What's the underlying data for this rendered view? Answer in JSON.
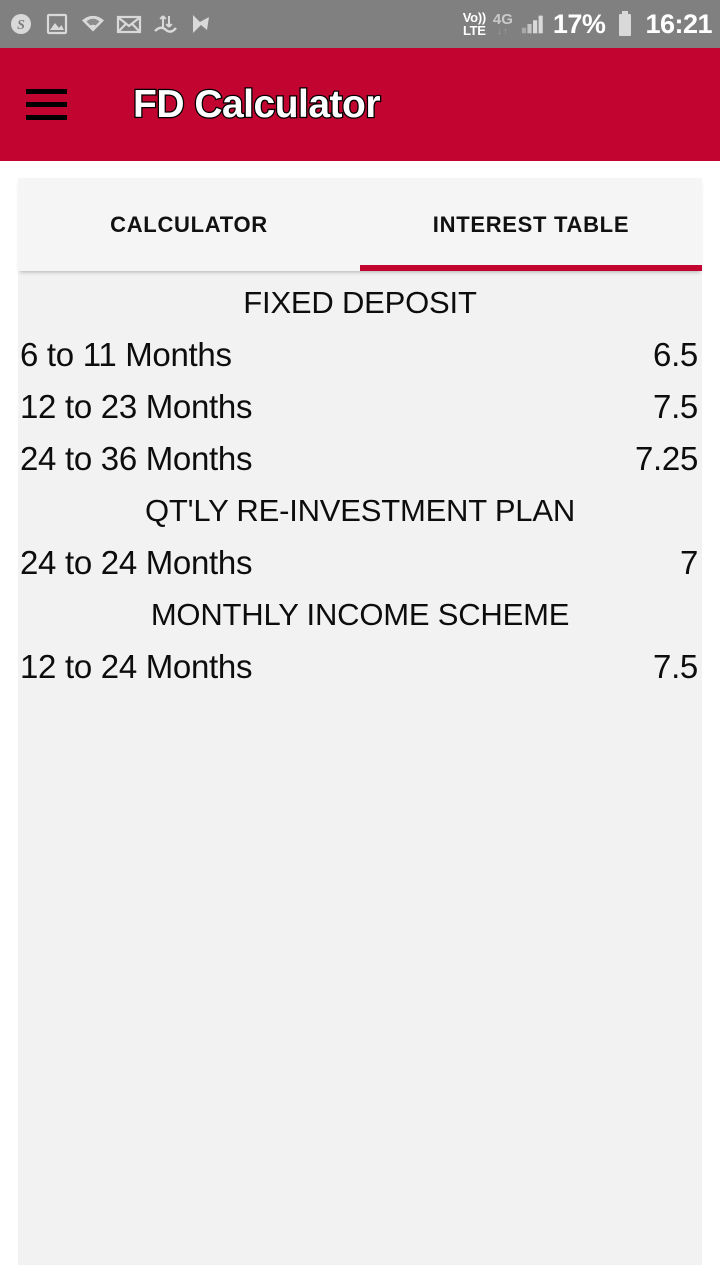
{
  "status_bar": {
    "left_icons": [
      {
        "name": "skype-icon",
        "glyph": "S"
      },
      {
        "name": "gallery-image-icon",
        "glyph": ""
      },
      {
        "name": "wifi-icon",
        "glyph": ""
      },
      {
        "name": "mail-icon",
        "glyph": ""
      },
      {
        "name": "data-transfer-icon",
        "glyph": ""
      },
      {
        "name": "checkmark-flag-icon",
        "glyph": ""
      }
    ],
    "volte_line1": "Vo))",
    "volte_line2": "LTE",
    "network_type": "4G",
    "network_arrows": "↓↑",
    "signal_icon": "signal-bars-icon",
    "battery_percent": "17%",
    "battery_icon": "battery-icon",
    "clock": "16:21"
  },
  "app_bar": {
    "menu_icon": "hamburger-menu-icon",
    "title": "FD Calculator",
    "background_color": "#c20430"
  },
  "tabs": [
    {
      "label": "CALCULATOR",
      "active": false
    },
    {
      "label": "INTEREST TABLE",
      "active": true
    }
  ],
  "interest_table": {
    "sections": [
      {
        "title": "FIXED DEPOSIT",
        "rows": [
          {
            "term": "6 to 11 Months",
            "rate": "6.5"
          },
          {
            "term": "12 to 23 Months",
            "rate": "7.5"
          },
          {
            "term": "24 to 36 Months",
            "rate": "7.25"
          }
        ]
      },
      {
        "title": "QT'LY RE-INVESTMENT PLAN",
        "rows": [
          {
            "term": "24 to 24 Months",
            "rate": "7"
          }
        ]
      },
      {
        "title": "MONTHLY INCOME SCHEME",
        "rows": [
          {
            "term": "12 to 24 Months",
            "rate": "7.5"
          }
        ]
      }
    ]
  },
  "colors": {
    "accent": "#c20430",
    "status_bar": "#808080",
    "card": "#f2f2f2",
    "tab_bar": "#f5f5f5"
  }
}
